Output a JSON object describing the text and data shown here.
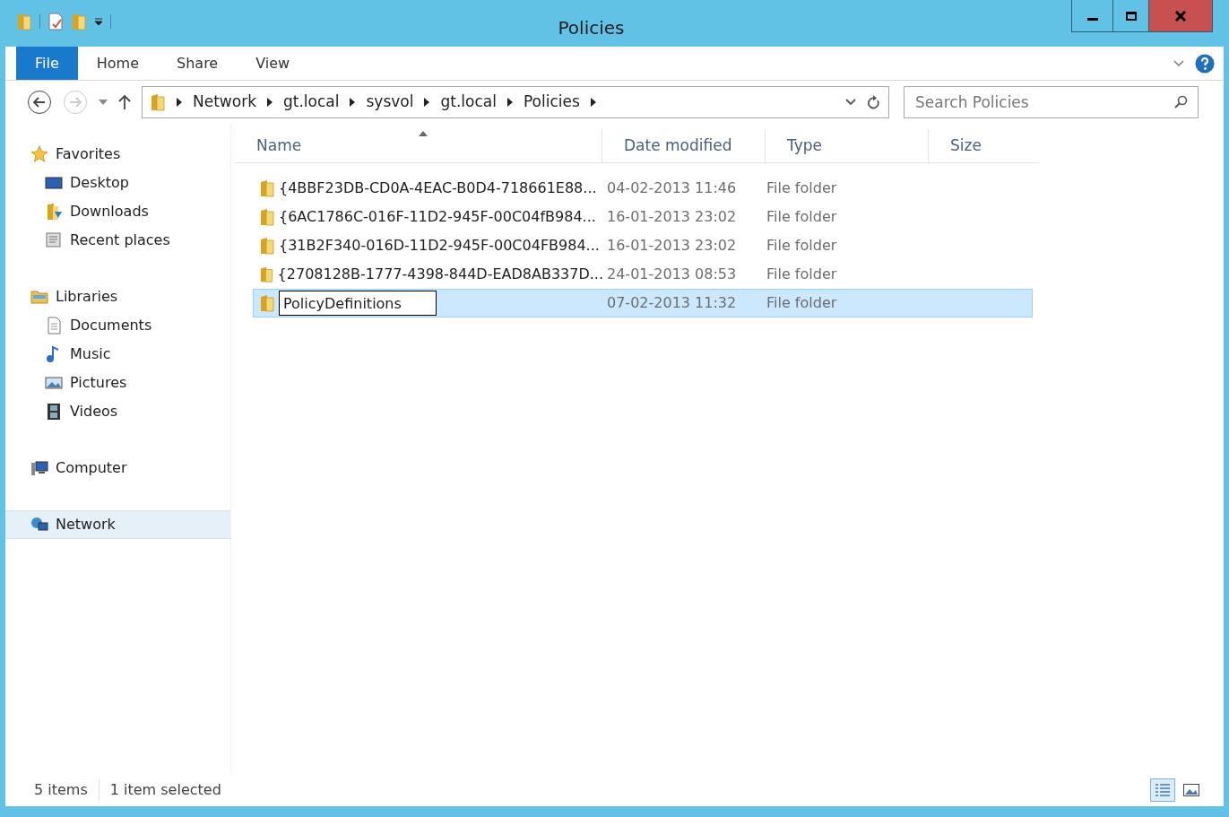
{
  "window": {
    "title": "Policies"
  },
  "ribbon_tabs": [
    {
      "label": "File",
      "selected": true
    },
    {
      "label": "Home",
      "selected": false
    },
    {
      "label": "Share",
      "selected": false
    },
    {
      "label": "View",
      "selected": false
    }
  ],
  "address": {
    "crumbs": [
      "Network",
      "gt.local",
      "sysvol",
      "gt.local",
      "Policies"
    ]
  },
  "search": {
    "placeholder": "Search Policies"
  },
  "sidebar": {
    "items": [
      {
        "label": "Favorites",
        "selected": false,
        "children": [
          {
            "label": "Desktop",
            "selected": false
          },
          {
            "label": "Downloads",
            "selected": false
          },
          {
            "label": "Recent places",
            "selected": false
          }
        ]
      },
      {
        "label": "Libraries",
        "selected": false,
        "children": [
          {
            "label": "Documents",
            "selected": false
          },
          {
            "label": "Music",
            "selected": false
          },
          {
            "label": "Pictures",
            "selected": false
          },
          {
            "label": "Videos",
            "selected": false
          }
        ]
      },
      {
        "label": "Computer",
        "selected": false
      },
      {
        "label": "Network",
        "selected": true
      }
    ]
  },
  "table": {
    "columns": [
      "Name",
      "Date modified",
      "Type",
      "Size"
    ],
    "rows": [
      {
        "name": "{4BBF23DB-CD0A-4EAC-B0D4-718661E88...",
        "date": "04-02-2013 11:46",
        "type": "File folder",
        "selected": false,
        "editing": false
      },
      {
        "name": "{6AC1786C-016F-11D2-945F-00C04fB984...",
        "date": "16-01-2013 23:02",
        "type": "File folder",
        "selected": false,
        "editing": false
      },
      {
        "name": "{31B2F340-016D-11D2-945F-00C04FB984...",
        "date": "16-01-2013 23:02",
        "type": "File folder",
        "selected": false,
        "editing": false
      },
      {
        "name": "{2708128B-1777-4398-844D-EAD8AB337D...",
        "date": "24-01-2013 08:53",
        "type": "File folder",
        "selected": false,
        "editing": false
      },
      {
        "name": "PolicyDefinitions",
        "date": "07-02-2013 11:32",
        "type": "File folder",
        "selected": true,
        "editing": true
      }
    ]
  },
  "status_bar": {
    "items": [
      "5 items",
      "1 item selected"
    ],
    "view_buttons": [
      {
        "selected": true
      },
      {
        "selected": false
      }
    ]
  }
}
